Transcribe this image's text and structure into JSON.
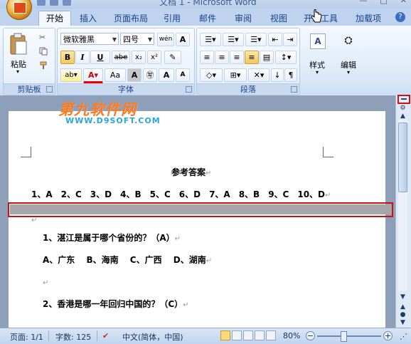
{
  "title_bar": {
    "title": "文档 1 - Microsoft Word"
  },
  "tabs": [
    {
      "label": "开始",
      "active": true
    },
    {
      "label": "插入"
    },
    {
      "label": "页面布局"
    },
    {
      "label": "引用"
    },
    {
      "label": "邮件"
    },
    {
      "label": "审阅"
    },
    {
      "label": "视图"
    },
    {
      "label": "开发工具"
    },
    {
      "label": "加载项"
    }
  ],
  "ribbon": {
    "clipboard": {
      "paste_label": "粘贴",
      "group_label": "剪贴板"
    },
    "font": {
      "font_name": "微软雅黑",
      "font_size": "四号",
      "group_label": "字体",
      "bold": "B",
      "italic": "I",
      "underline": "U",
      "strike": "abe",
      "subscript": "x₂",
      "superscript": "x²",
      "case": "Aa",
      "grow": "A",
      "shrink": "A"
    },
    "paragraph": {
      "group_label": "段落"
    },
    "styles": {
      "label": "样式"
    },
    "editing": {
      "label": "编辑"
    }
  },
  "watermark": {
    "brand": "第九软件网",
    "url": "WWW.D9SOFT.COM"
  },
  "document": {
    "heading": "参考答案",
    "answers": "1、A　2、C　3、D　4、B　5、C　6、D　7、A　8、B　9、C　10、D",
    "q1": "1、湛江是属于哪个省份的？（A）",
    "q1_options": "A、广东　 B、海南　 C、广西　 D、湖南",
    "q2": "2、香港是哪一年回归中国的？（C）",
    "paragraph_mark": "↵"
  },
  "status_bar": {
    "page": "页面: 1/1",
    "words": "字数: 125",
    "language": "中文(简体，中国)",
    "zoom": "80%",
    "zoom_level_percent": 80
  },
  "colors": {
    "accent_red": "#d01010",
    "watermark_orange": "#ff7a1a",
    "watermark_blue": "#2aa5e0"
  }
}
